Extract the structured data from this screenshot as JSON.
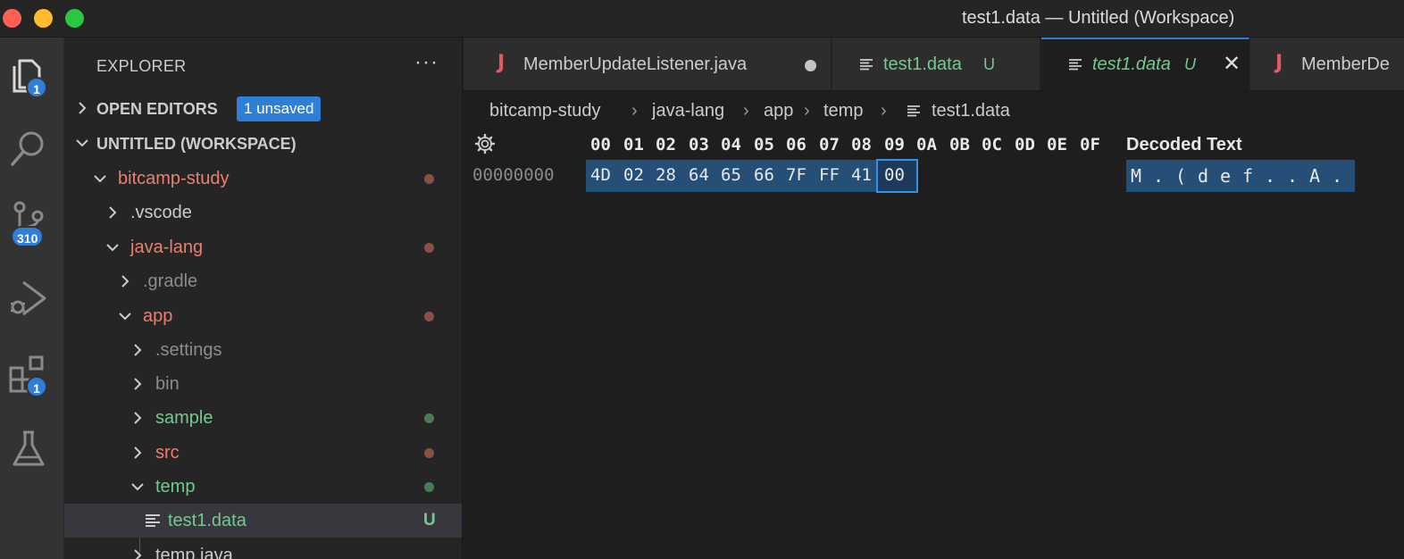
{
  "window": {
    "title": "test1.data — Untitled (Workspace)"
  },
  "activity_bar": {
    "items": [
      {
        "icon": "files-icon",
        "badge": "1"
      },
      {
        "icon": "search-icon"
      },
      {
        "icon": "source-control-icon",
        "badge": "310"
      },
      {
        "icon": "run-debug-icon"
      },
      {
        "icon": "extensions-icon",
        "badge": "1"
      },
      {
        "icon": "testing-flask-icon"
      }
    ]
  },
  "sidebar": {
    "title": "EXPLORER",
    "more_label": "···",
    "open_editors": {
      "label": "OPEN EDITORS",
      "badge": "1 unsaved"
    },
    "workspace": {
      "label": "UNTITLED (WORKSPACE)"
    },
    "tree": [
      {
        "label": "bitcamp-study",
        "expanded": true,
        "status": "modified"
      },
      {
        "label": ".vscode",
        "expanded": false,
        "status": "none"
      },
      {
        "label": "java-lang",
        "expanded": true,
        "status": "modified"
      },
      {
        "label": ".gradle",
        "expanded": false,
        "status": "ignored"
      },
      {
        "label": "app",
        "expanded": true,
        "status": "modified"
      },
      {
        "label": ".settings",
        "expanded": false,
        "status": "ignored"
      },
      {
        "label": "bin",
        "expanded": false,
        "status": "ignored"
      },
      {
        "label": "sample",
        "expanded": false,
        "status": "untracked"
      },
      {
        "label": "src",
        "expanded": false,
        "status": "modified"
      },
      {
        "label": "temp",
        "expanded": true,
        "status": "untracked"
      },
      {
        "label": "test1.data",
        "file": true,
        "status": "U"
      },
      {
        "label": "temp.java",
        "expanded": false,
        "status": "none"
      }
    ]
  },
  "tabs": [
    {
      "icon": "J",
      "label": "MemberUpdateListener.java",
      "dirty": true
    },
    {
      "icon": "file-lines-icon",
      "label": "test1.data",
      "git": "U"
    },
    {
      "icon": "file-lines-icon",
      "label": "test1.data",
      "git": "U",
      "active": true,
      "preview": true,
      "close": "✕"
    },
    {
      "icon": "J",
      "label": "MemberDe"
    }
  ],
  "breadcrumb": [
    "bitcamp-study",
    "java-lang",
    "app",
    "temp",
    "test1.data"
  ],
  "breadcrumb_sep": "›",
  "hex_editor": {
    "columns": [
      "00",
      "01",
      "02",
      "03",
      "04",
      "05",
      "06",
      "07",
      "08",
      "09",
      "0A",
      "0B",
      "0C",
      "0D",
      "0E",
      "0F"
    ],
    "decoded_header": "Decoded Text",
    "rows": [
      {
        "offset": "00000000",
        "bytes": [
          "4D",
          "02",
          "28",
          "64",
          "65",
          "66",
          "7F",
          "FF",
          "41",
          "00"
        ],
        "decoded": [
          "M",
          ".",
          "(",
          "d",
          "e",
          "f",
          ".",
          ".",
          "A",
          "."
        ]
      }
    ],
    "focused_byte_index": 9
  },
  "colors": {
    "accent": "#2f7fd6",
    "modified": "#e8806f",
    "untracked": "#73c991",
    "ignored": "#8c8c8c",
    "selection": "#264f78"
  }
}
